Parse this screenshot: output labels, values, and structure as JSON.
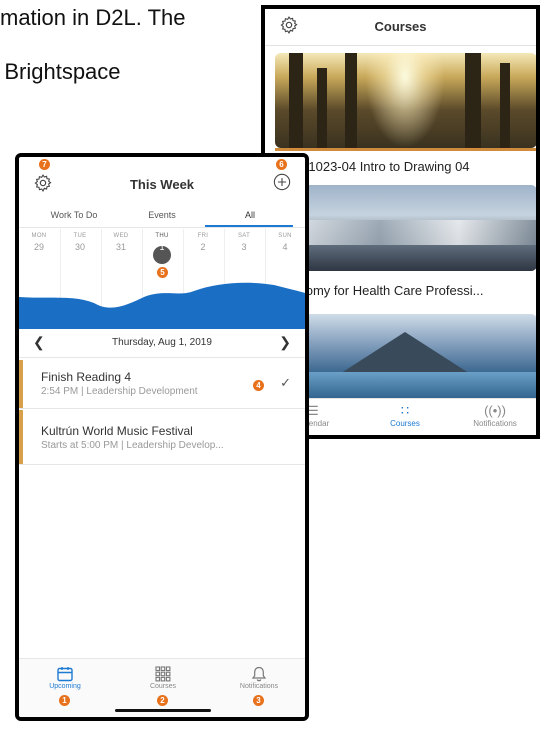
{
  "doc": {
    "line1": "mation in D2L. The",
    "line2": "o Brightspace"
  },
  "courses_screen": {
    "title": "Courses",
    "cards": [
      {
        "label": "ART-1023-04 Intro to Drawing 04"
      },
      {
        "label": "Anatomy for Health Care Professi..."
      }
    ],
    "tabs": [
      {
        "label": "Calendar",
        "icon": "calendar-icon"
      },
      {
        "label": "Courses",
        "icon": "grid-icon"
      },
      {
        "label": "Notifications",
        "icon": "broadcast-icon"
      }
    ],
    "active_tab": "Courses"
  },
  "week_screen": {
    "title": "This Week",
    "segments": [
      "Work To Do",
      "Events",
      "All"
    ],
    "active_segment": "All",
    "days": [
      {
        "name": "MON",
        "date": "29"
      },
      {
        "name": "TUE",
        "date": "30"
      },
      {
        "name": "WED",
        "date": "31"
      },
      {
        "name": "THU",
        "date": "1"
      },
      {
        "name": "FRI",
        "date": "2"
      },
      {
        "name": "SAT",
        "date": "3"
      },
      {
        "name": "SUN",
        "date": "4"
      }
    ],
    "selected_day": "THU",
    "date_label": "Thursday, Aug 1, 2019",
    "items": [
      {
        "title": "Finish Reading 4",
        "subtitle": "2:54 PM | Leadership Development"
      },
      {
        "title": "Kultrún World Music Festival",
        "subtitle": "Starts at 5:00 PM | Leadership Develop..."
      }
    ],
    "tabs": [
      {
        "label": "Upcoming",
        "icon": "calendar-icon"
      },
      {
        "label": "Courses",
        "icon": "grid-icon"
      },
      {
        "label": "Notifications",
        "icon": "bell-icon"
      }
    ],
    "active_tab": "Upcoming",
    "badges": {
      "upcoming": "1",
      "courses": "2",
      "notifications": "3",
      "item": "4",
      "day": "5",
      "add": "6",
      "settings": "7"
    }
  },
  "colors": {
    "accent": "#1d7ad2",
    "badge": "#e8711b",
    "stripe": "#d8a04a",
    "wave": "#1a6fc4"
  }
}
